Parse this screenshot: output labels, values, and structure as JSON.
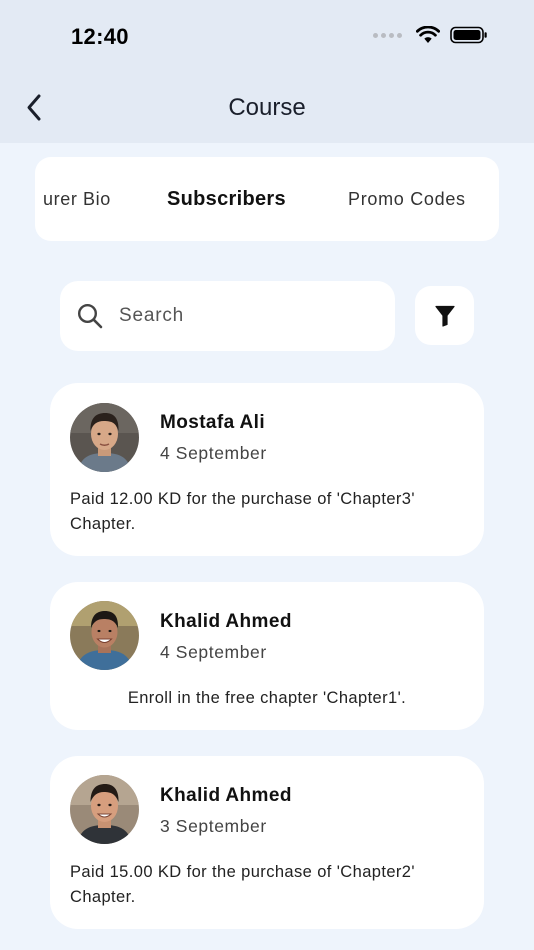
{
  "status_bar": {
    "time": "12:40"
  },
  "header": {
    "title": "Course"
  },
  "tabs": [
    {
      "label": "urer Bio"
    },
    {
      "label": "Subscribers"
    },
    {
      "label": "Promo Codes"
    }
  ],
  "search": {
    "placeholder": "Search"
  },
  "subscribers": [
    {
      "name": "Mostafa Ali",
      "date": "4 September",
      "message": "Paid 12.00 KD for the purchase of 'Chapter3' Chapter."
    },
    {
      "name": "Khalid Ahmed",
      "date": "4 September",
      "message": "Enroll in the free chapter 'Chapter1'."
    },
    {
      "name": "Khalid Ahmed",
      "date": "3 September",
      "message": "Paid 15.00 KD for the purchase of 'Chapter2' Chapter."
    }
  ]
}
